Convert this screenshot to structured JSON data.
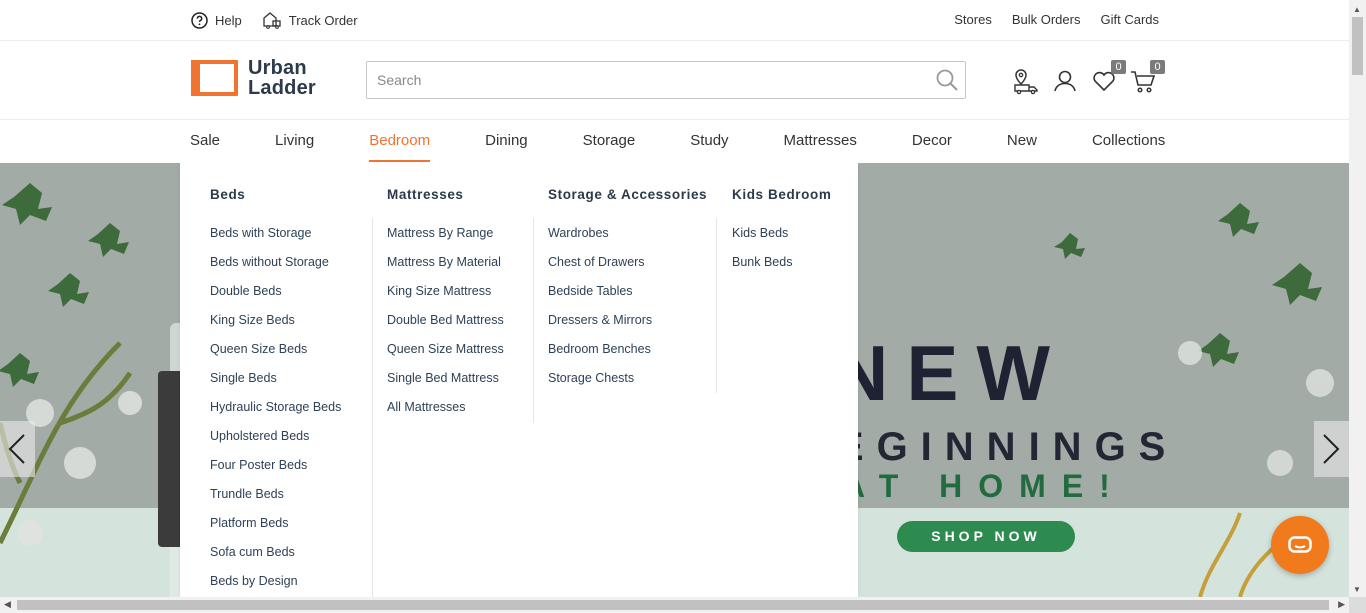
{
  "topbar": {
    "help": "Help",
    "track_order": "Track Order",
    "stores": "Stores",
    "bulk_orders": "Bulk Orders",
    "gift_cards": "Gift Cards"
  },
  "logo": {
    "line1": "Urban",
    "line2": "Ladder"
  },
  "search": {
    "placeholder": "Search"
  },
  "header_icons": {
    "wishlist_count": "0",
    "cart_count": "0"
  },
  "nav": {
    "items": [
      "Sale",
      "Living",
      "Bedroom",
      "Dining",
      "Storage",
      "Study",
      "Mattresses",
      "Decor",
      "New",
      "Collections"
    ],
    "active": "Bedroom"
  },
  "megamenu": {
    "beds": {
      "title": "Beds",
      "items": [
        "Beds with Storage",
        "Beds without Storage",
        "Double Beds",
        "King Size Beds",
        "Queen Size Beds",
        "Single Beds",
        "Hydraulic Storage Beds",
        "Upholstered Beds",
        "Four Poster Beds",
        "Trundle Beds",
        "Platform Beds",
        "Sofa cum Beds",
        "Beds by Design"
      ]
    },
    "mattresses": {
      "title": "Mattresses",
      "items": [
        "Mattress By Range",
        "Mattress By Material",
        "King Size Mattress",
        "Double Bed Mattress",
        "Queen Size Mattress",
        "Single Bed Mattress",
        "All Mattresses"
      ]
    },
    "storage": {
      "title": "Storage & Accessories",
      "items": [
        "Wardrobes",
        "Chest of Drawers",
        "Bedside Tables",
        "Dressers & Mirrors",
        "Bedroom Benches",
        "Storage Chests"
      ]
    },
    "kids": {
      "title": "Kids Bedroom",
      "items": [
        "Kids Beds",
        "Bunk Beds"
      ]
    }
  },
  "hero": {
    "headline": "NEW",
    "line2": "BEGINNINGS",
    "line3": "AT HOME!",
    "cta": "SHOP NOW"
  },
  "colors": {
    "accent": "#f0742f",
    "text_dark": "#2c3a4c",
    "cta_green": "#2e8b50"
  }
}
